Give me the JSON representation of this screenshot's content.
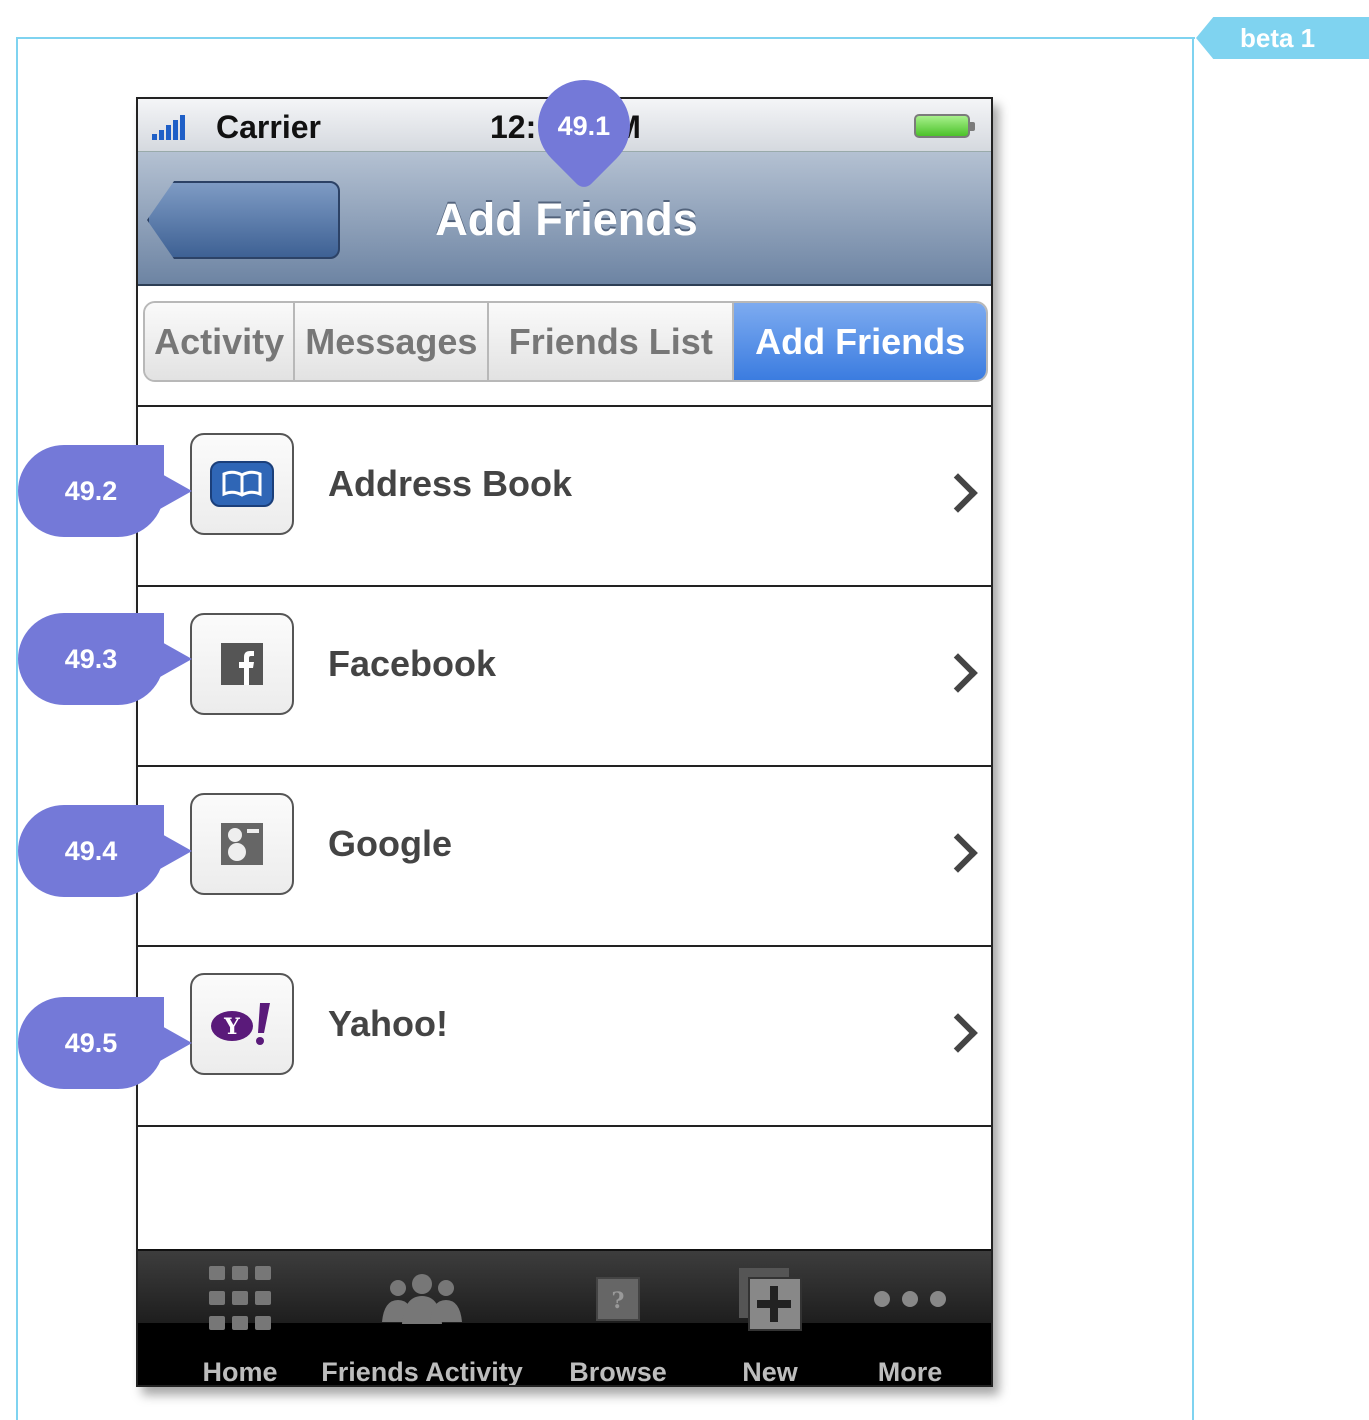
{
  "wireframe": {
    "version_tag": "beta 1"
  },
  "status_bar": {
    "carrier": "Carrier",
    "time_prefix": "12:",
    "time_suffix": "M"
  },
  "nav_bar": {
    "title": "Add Friends"
  },
  "segments": [
    {
      "label": "Activity",
      "active": false
    },
    {
      "label": "Messages",
      "active": false
    },
    {
      "label": "Friends List",
      "active": false
    },
    {
      "label": "Add Friends",
      "active": true
    }
  ],
  "rows": [
    {
      "label": "Address Book",
      "icon": "address-book-icon"
    },
    {
      "label": "Facebook",
      "icon": "facebook-icon"
    },
    {
      "label": "Google",
      "icon": "google-icon"
    },
    {
      "label": "Yahoo!",
      "icon": "yahoo-icon"
    }
  ],
  "tab_bar": [
    {
      "label": "Home",
      "icon": "grid-icon"
    },
    {
      "label": "Friends Activity",
      "icon": "people-icon"
    },
    {
      "label": "Browse",
      "icon": "question-icon"
    },
    {
      "label": "New",
      "icon": "plus-icon"
    },
    {
      "label": "More",
      "icon": "more-dots-icon"
    }
  ],
  "callouts": [
    "49.1",
    "49.2",
    "49.3",
    "49.4",
    "49.5"
  ],
  "colors": {
    "frame": "#7fd3f0",
    "callout": "#7479d8",
    "active_segment": "#3b7ce0"
  }
}
